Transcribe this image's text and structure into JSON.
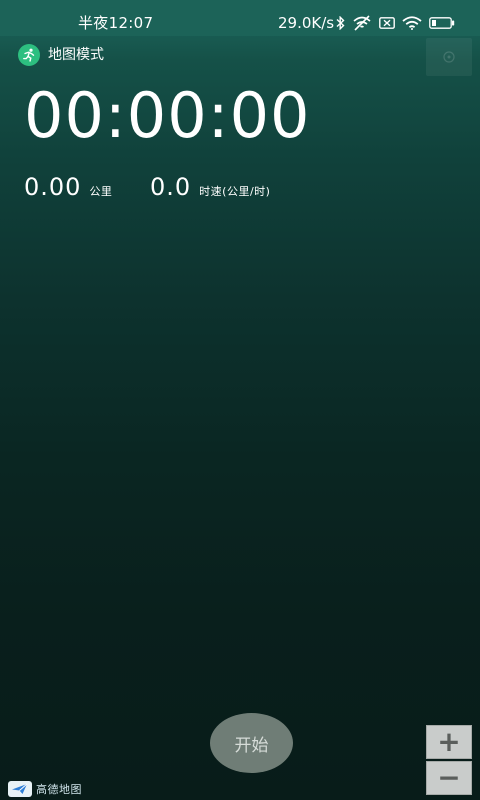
{
  "status_bar": {
    "time": "半夜12:07",
    "network_speed": "29.0K/s",
    "icons": [
      "bluetooth-icon",
      "no-sim-icon",
      "sim-x-icon",
      "wifi-icon",
      "battery-icon"
    ],
    "battery_level": "3"
  },
  "map_mode": {
    "label": "地图模式",
    "icon": "running-person-icon"
  },
  "timer": {
    "value": "00:00:00"
  },
  "distance": {
    "value": "0.00",
    "unit": "公里"
  },
  "speed": {
    "value": "0.0",
    "unit": "时速(公里/时)"
  },
  "start_button": {
    "label": "开始"
  },
  "zoom": {
    "in_label": "+",
    "out_label": "−"
  },
  "map_logo": {
    "text": "高德地图"
  },
  "colors": {
    "accent": "#2dbf80",
    "status_bar": "#1c6358",
    "start_button": "#6f7d76"
  }
}
